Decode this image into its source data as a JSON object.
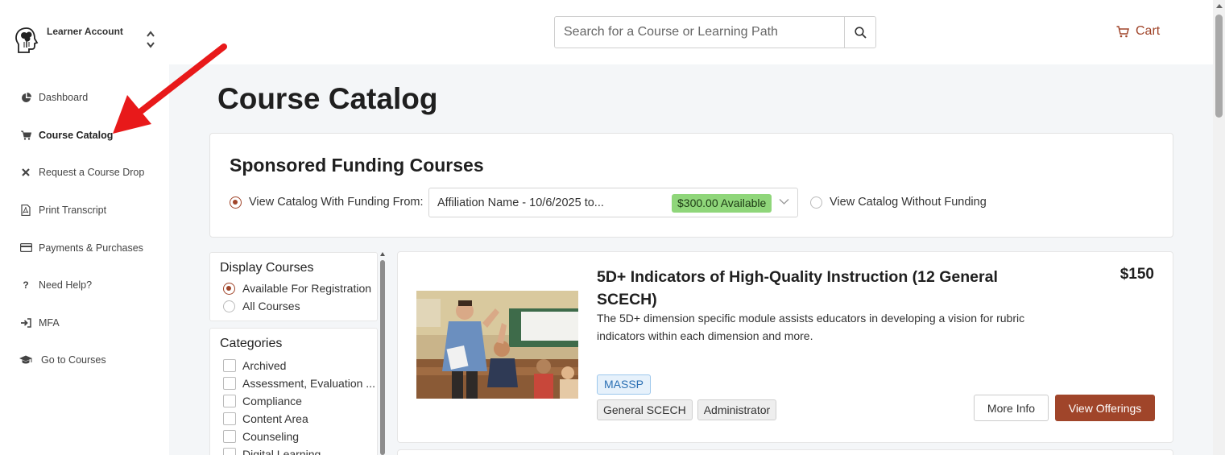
{
  "account": {
    "label": "Learner Account",
    "logo_icon": "brain-head-icon",
    "switch_icon": "chevron-up-down-icon"
  },
  "sidebar": {
    "items": [
      {
        "label": "Dashboard",
        "icon": "pie-chart-icon",
        "active": false
      },
      {
        "label": "Course Catalog",
        "icon": "cart-icon",
        "active": true
      },
      {
        "label": "Request a Course Drop",
        "icon": "x-icon",
        "active": false
      },
      {
        "label": "Print Transcript",
        "icon": "pdf-file-icon",
        "active": false
      },
      {
        "label": "Payments & Purchases",
        "icon": "credit-card-icon",
        "active": false
      },
      {
        "label": "Need Help?",
        "icon": "question-icon",
        "active": false
      },
      {
        "label": "MFA",
        "icon": "sign-in-icon",
        "active": false
      },
      {
        "label": "Go to Courses",
        "icon": "graduation-cap-icon",
        "active": false
      }
    ]
  },
  "search": {
    "placeholder": "Search for a Course or Learning Path"
  },
  "cart": {
    "label": "Cart"
  },
  "page": {
    "title": "Course Catalog"
  },
  "funding": {
    "title": "Sponsored Funding Courses",
    "option_with": "View Catalog With Funding From:",
    "selected_affiliation": "Affiliation Name - 10/6/2025 to...",
    "available": "$300.00 Available",
    "option_without": "View Catalog Without Funding"
  },
  "filters": {
    "display": {
      "title": "Display Courses",
      "options": [
        "Available For Registration",
        "All Courses"
      ],
      "selected_index": 0
    },
    "categories": {
      "title": "Categories",
      "items": [
        "Archived",
        "Assessment, Evaluation ...",
        "Compliance",
        "Content Area",
        "Counseling",
        "Digital Learning"
      ]
    }
  },
  "course": {
    "title": "5D+ Indicators of High-Quality Instruction (12 General SCECH)",
    "description": "The 5D+ dimension specific module assists educators in developing a vision for rubric indicators within each dimension and more.",
    "price": "$150",
    "provider_tag": "MASSP",
    "tags": [
      "General SCECH",
      "Administrator"
    ],
    "more_info_label": "More Info",
    "view_offerings_label": "View Offerings"
  },
  "colors": {
    "accent": "#a0452a",
    "available_badge": "#8fd67a",
    "annotation_arrow": "#e8191a"
  }
}
